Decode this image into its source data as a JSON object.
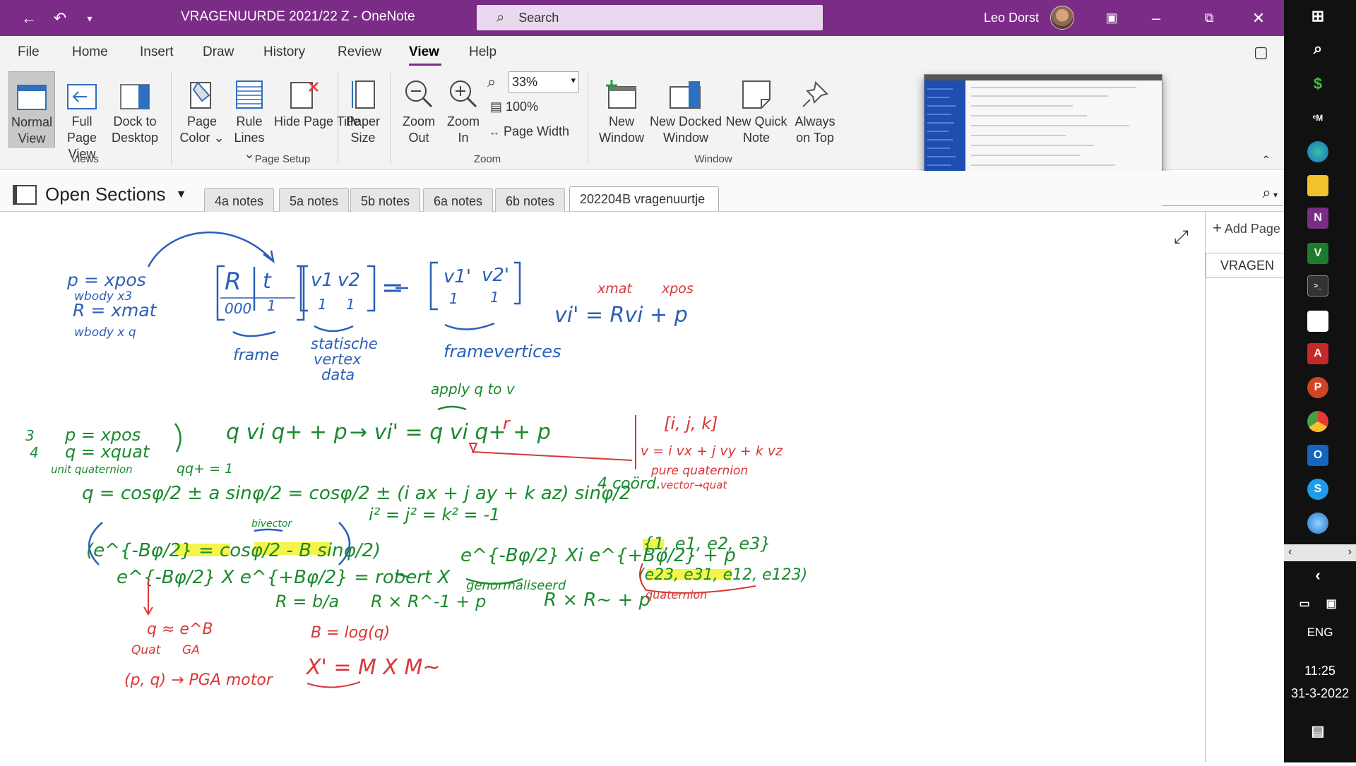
{
  "titlebar": {
    "title": "VRAGENUURDE 2021/22 Z  -  OneNote",
    "search_placeholder": "Search",
    "user_name": "Leo Dorst"
  },
  "menu": [
    "File",
    "Home",
    "Insert",
    "Draw",
    "History",
    "Review",
    "View",
    "Help"
  ],
  "ribbon": {
    "views": {
      "normal_view": "Normal View",
      "full_page_view": "Full Page View",
      "dock_to_desktop": "Dock to Desktop",
      "label": "Views"
    },
    "page_setup": {
      "page_color": "Page Color",
      "rule_lines": "Rule Lines",
      "hide_page_title": "Hide Page Title",
      "paper_size": "Paper Size",
      "label": "Page Setup"
    },
    "zoom": {
      "zoom_out": "Zoom Out",
      "zoom_in": "Zoom In",
      "zoom_value": "33%",
      "hundred": "100%",
      "page_width": "Page Width",
      "label": "Zoom"
    },
    "window": {
      "new_window": "New Window",
      "new_docked_window": "New Docked Window",
      "new_quick_note": "New Quick Note",
      "always_on_top": "Always on Top",
      "label": "Window"
    }
  },
  "sections": {
    "open_sections": "Open Sections",
    "tabs": [
      "4a notes",
      "5a notes",
      "5b notes",
      "6a notes",
      "6b notes",
      "202204B vragenuurtje"
    ]
  },
  "pages": {
    "add_page": "Add Page",
    "items": [
      "VRAGEN"
    ]
  },
  "tray": {
    "lang": "ENG",
    "time": "11:25",
    "date": "31-3-2022"
  },
  "ink": {
    "blue": [
      "p = xpos",
      "wbody x3",
      "R = xmat",
      "wbody x q",
      "R",
      "t",
      "000",
      "1",
      "v1",
      "v2",
      "1",
      "1",
      "=",
      "v1'",
      "v2'",
      "1",
      "1",
      "frame",
      "statische",
      "vertex",
      "data",
      "framevertices",
      "vi' = Rvi + p"
    ],
    "red": [
      "xmat",
      "xpos",
      "[i, j, k]",
      "v = i vx + j vy + k vz",
      "pure quaternion",
      "vector→quat",
      "B = log(q)",
      "q ≈ e^B",
      "Quat",
      "GA",
      "(p, q) → PGA motor",
      "X' = M X M~",
      "r"
    ],
    "green": [
      "apply q to v",
      "3",
      "4",
      "p = xpos",
      "q = xquat",
      "unit quaternion",
      "qq+ = 1",
      "q = cosφ/2 ± a sinφ/2 = cosφ/2 ± (i ax + j ay + k az) sinφ/2",
      "4 coörd.",
      "i² = j² = k² = -1",
      "(e^{-Bφ/2} = cosφ/2 - B sinφ/2)",
      "bivector",
      "e^{-Bφ/2} X e^{+Bφ/2} = robert X",
      "R = b/a",
      "R × R^-1 + p",
      "e^{-Bφ/2} Xi e^{+Bφ/2} + p",
      "genormaliseerd",
      "R × R~ + p",
      "{1, e1, e2, e3}",
      "(e23, e31, e12, e123)",
      "quaternion",
      "q vi q+ + p",
      "→ vi' = q vi q+ + p"
    ]
  },
  "colors": {
    "brand": "#7b2c87",
    "ink_blue": "#2b5fb8",
    "ink_green": "#1a8a2e",
    "ink_red": "#d93636",
    "highlight": "#f2f22a"
  }
}
